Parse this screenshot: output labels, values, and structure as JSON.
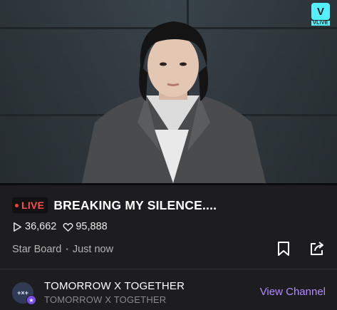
{
  "video": {
    "logo_text": "VLIVE",
    "logo_glyph": "V",
    "colors": {
      "logo": "#54f0ff"
    }
  },
  "live": {
    "badge_label": "LIVE",
    "title": "BREAKING MY SILENCE....",
    "colors": {
      "live": "#ff4d4d"
    }
  },
  "stats": {
    "views": "36,662",
    "views_icon": "play-icon",
    "likes": "95,888",
    "likes_icon": "heart-icon"
  },
  "board": {
    "label": "Star Board",
    "time": "Just now"
  },
  "actions": {
    "bookmark_icon": "bookmark-icon",
    "share_icon": "share-icon"
  },
  "channel": {
    "name": "TOMORROW X TOGETHER",
    "subtitle": "TOMORROW X TOGETHER",
    "avatar_text": "+×+",
    "view_label": "View Channel",
    "colors": {
      "view_channel": "#b18cff"
    }
  }
}
